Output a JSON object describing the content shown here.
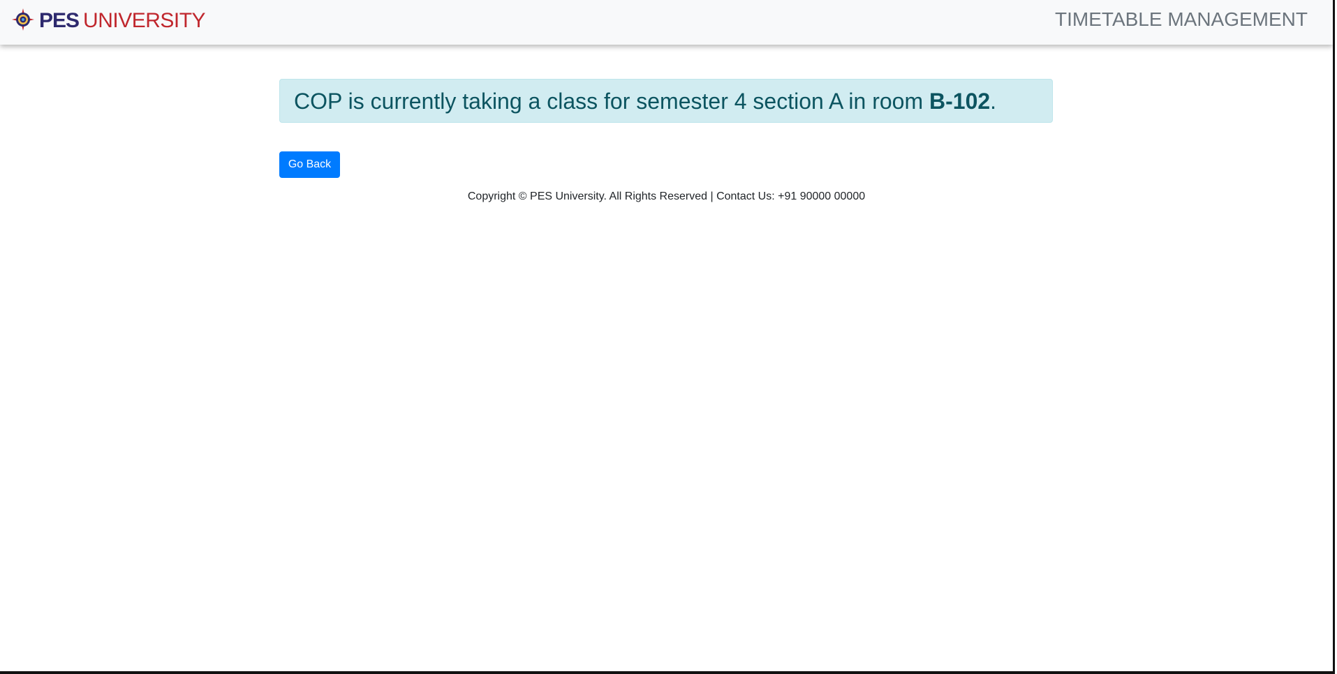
{
  "navbar": {
    "logo_icon": "pes-emblem-icon",
    "brand_strong": "PES",
    "brand_light": "UNIVERSITY",
    "app_title": "TIMETABLE MANAGEMENT"
  },
  "alert": {
    "message_prefix": "COP is currently taking a class for semester 4 section A in room",
    "room": "B-102",
    "suffix": "."
  },
  "actions": {
    "go_back_label": "Go Back"
  },
  "footer": {
    "text": "Copyright © PES University. All Rights Reserved | Contact Us: +91 90000 00000"
  },
  "colors": {
    "navbar_bg": "#f8f9fa",
    "brand_navy": "#2e2a6e",
    "brand_red": "#c0272d",
    "alert_bg": "#d1ecf1",
    "alert_text": "#0c5460",
    "primary_button": "#007bff"
  }
}
